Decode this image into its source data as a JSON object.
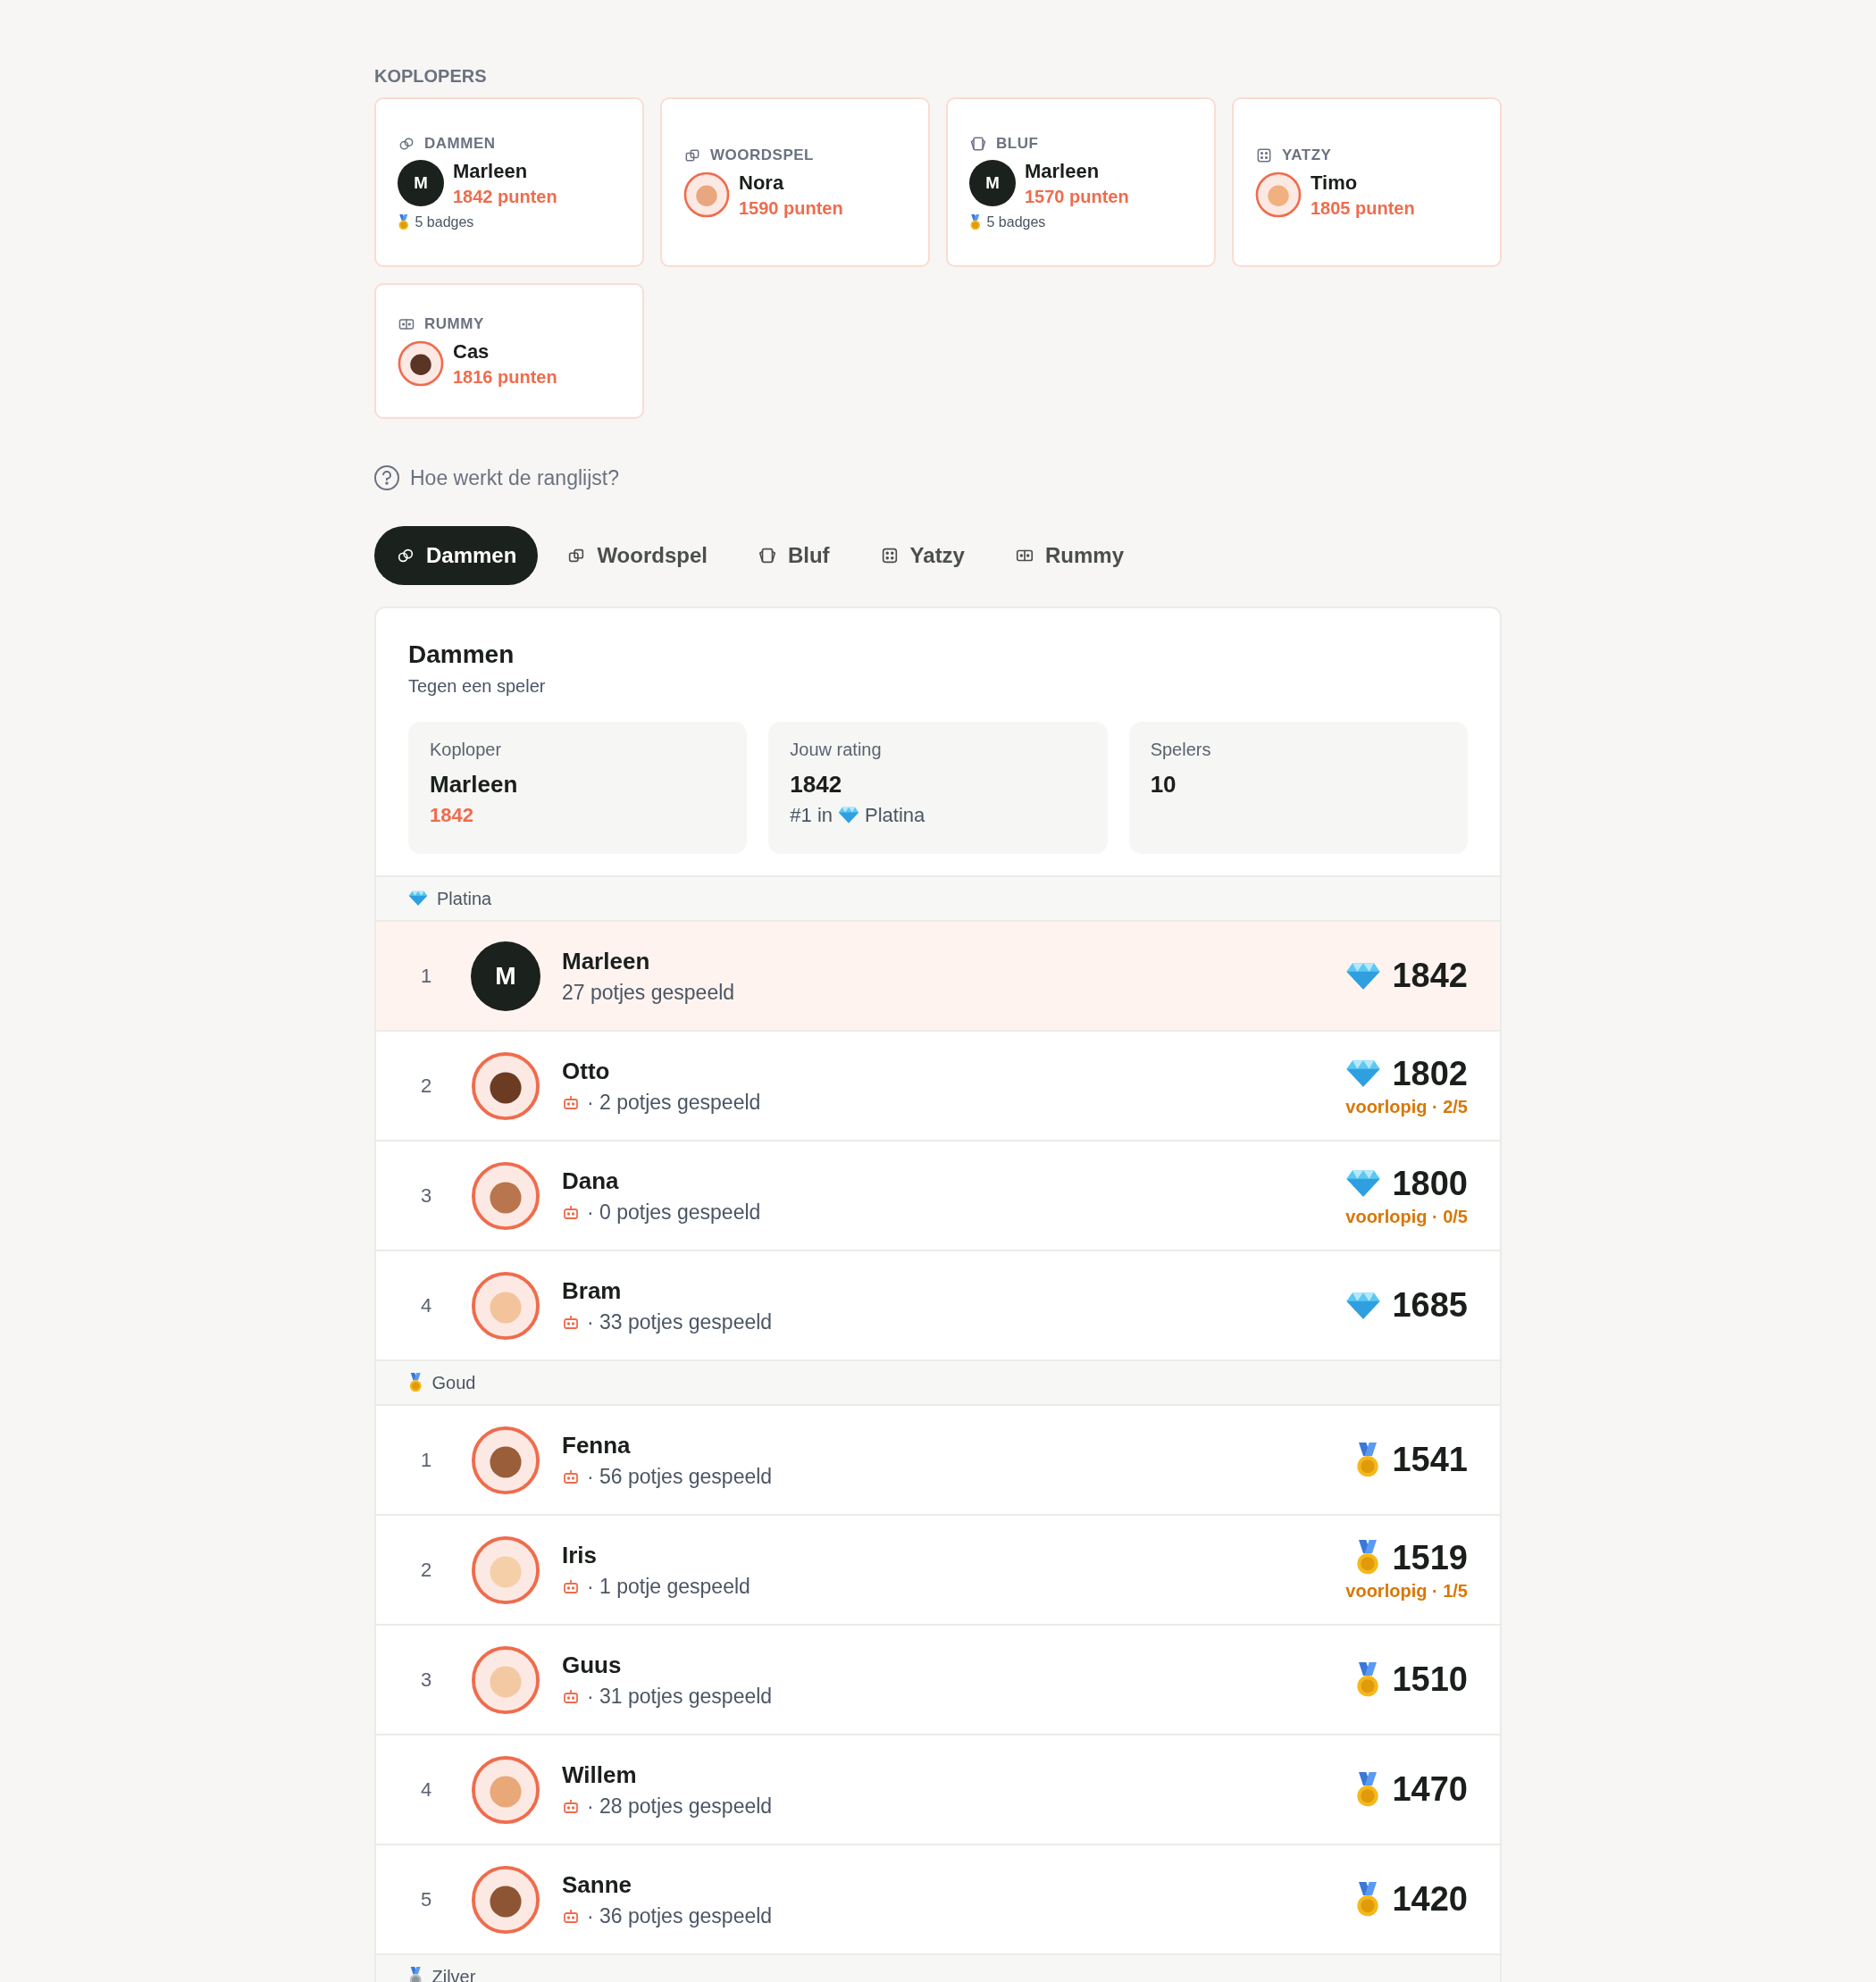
{
  "leaders_heading": "KOPLOPERS",
  "leaders": [
    {
      "game": "DAMMEN",
      "kind": "rings",
      "name": "Marleen",
      "points": "1842 punten",
      "avatar": {
        "kind": "initial",
        "text": "M"
      },
      "badges": "5 badges"
    },
    {
      "game": "WOORDSPEL",
      "kind": "squares",
      "name": "Nora",
      "points": "1590 punten",
      "avatar": {
        "kind": "figure",
        "color": "#e8a77e"
      }
    },
    {
      "game": "BLUF",
      "kind": "cards",
      "name": "Marleen",
      "points": "1570 punten",
      "avatar": {
        "kind": "initial",
        "text": "M"
      },
      "badges": "5 badges"
    },
    {
      "game": "YATZY",
      "kind": "dice",
      "name": "Timo",
      "points": "1805 punten",
      "avatar": {
        "kind": "figure",
        "color": "#f0b080"
      }
    },
    {
      "game": "RUMMY",
      "kind": "tiles",
      "name": "Cas",
      "points": "1816 punten",
      "avatar": {
        "kind": "figure",
        "color": "#5a3424"
      }
    }
  ],
  "help_link": "Hoe werkt de ranglijst?",
  "tabs": [
    {
      "label": "Dammen",
      "kind": "rings",
      "selected": true
    },
    {
      "label": "Woordspel",
      "kind": "squares",
      "selected": false
    },
    {
      "label": "Bluf",
      "kind": "cards",
      "selected": false
    },
    {
      "label": "Yatzy",
      "kind": "dice",
      "selected": false
    },
    {
      "label": "Rummy",
      "kind": "tiles",
      "selected": false
    }
  ],
  "panel": {
    "title": "Dammen",
    "subtitle": "Tegen een speler",
    "stats": [
      {
        "label": "Koploper",
        "value": "Marleen",
        "note": "1842",
        "accent": true
      },
      {
        "label": "Jouw rating",
        "value": "1842",
        "note": "#1 in",
        "tier": {
          "kind": "diamond",
          "label": "Platina"
        },
        "accent": false
      },
      {
        "label": "Spelers",
        "value": "10"
      }
    ],
    "groups": [
      {
        "name": "Platina",
        "kind": "diamond",
        "rows": [
          {
            "rank": "1",
            "name": "Marleen",
            "games": "27 potjes gespeeld",
            "bot": false,
            "highlighted": true,
            "avatar": {
              "kind": "initial",
              "text": "M"
            },
            "rating": "1842"
          },
          {
            "rank": "2",
            "name": "Otto",
            "games": "· 2 potjes gespeeld",
            "bot": true,
            "highlighted": false,
            "avatar": {
              "kind": "figure",
              "color": "#6b3b22"
            },
            "rating": "1802",
            "provisional": "voorlopig · 2/5"
          },
          {
            "rank": "3",
            "name": "Dana",
            "games": "· 0 potjes gespeeld",
            "bot": true,
            "highlighted": false,
            "avatar": {
              "kind": "figure",
              "color": "#b9754e"
            },
            "rating": "1800",
            "provisional": "voorlopig · 0/5"
          },
          {
            "rank": "4",
            "name": "Bram",
            "games": "· 33 potjes gespeeld",
            "bot": true,
            "highlighted": false,
            "avatar": {
              "kind": "figure",
              "color": "#f3c49c"
            },
            "rating": "1685"
          }
        ]
      },
      {
        "name": "Goud",
        "kind": "gold",
        "rows": [
          {
            "rank": "1",
            "name": "Fenna",
            "games": "· 56 potjes gespeeld",
            "bot": true,
            "highlighted": false,
            "avatar": {
              "kind": "figure",
              "color": "#9a5e3a"
            },
            "rating": "1541"
          },
          {
            "rank": "2",
            "name": "Iris",
            "games": "· 1 potje gespeeld",
            "bot": true,
            "highlighted": false,
            "avatar": {
              "kind": "figure",
              "color": "#f5cfa8"
            },
            "rating": "1519",
            "provisional": "voorlopig · 1/5"
          },
          {
            "rank": "3",
            "name": "Guus",
            "games": "· 31 potjes gespeeld",
            "bot": true,
            "highlighted": false,
            "avatar": {
              "kind": "figure",
              "color": "#f3c9a4"
            },
            "rating": "1510"
          },
          {
            "rank": "4",
            "name": "Willem",
            "games": "· 28 potjes gespeeld",
            "bot": true,
            "highlighted": false,
            "avatar": {
              "kind": "figure",
              "color": "#e9a878"
            },
            "rating": "1470"
          },
          {
            "rank": "5",
            "name": "Sanne",
            "games": "· 36 potjes gespeeld",
            "bot": true,
            "highlighted": false,
            "avatar": {
              "kind": "figure",
              "color": "#8d5534"
            },
            "rating": "1420"
          }
        ]
      },
      {
        "name": "Zilver",
        "kind": "silver"
      }
    ]
  }
}
